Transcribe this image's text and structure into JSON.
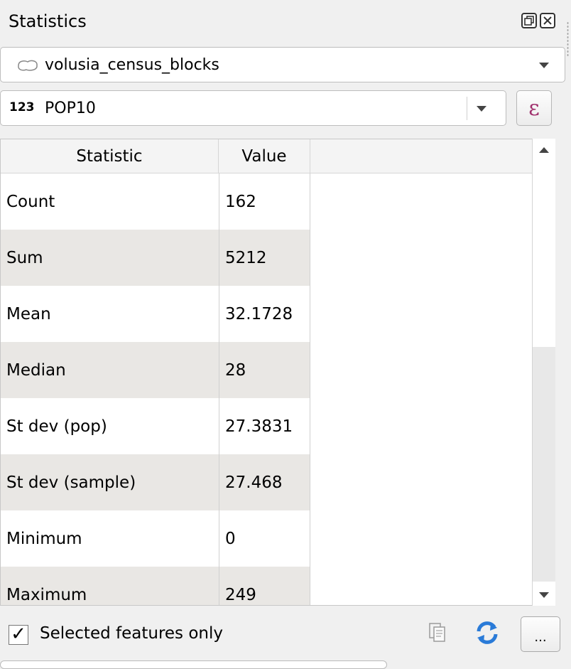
{
  "panel": {
    "title": "Statistics"
  },
  "layer_selector": {
    "value": "volusia_census_blocks",
    "icon": "polygon-layer-icon"
  },
  "field_selector": {
    "type_label": "123",
    "value": "POP10",
    "expression_label": "ε"
  },
  "table": {
    "headers": [
      "Statistic",
      "Value"
    ],
    "rows": [
      {
        "statistic": "Count",
        "value": "162"
      },
      {
        "statistic": "Sum",
        "value": "5212"
      },
      {
        "statistic": "Mean",
        "value": "32.1728"
      },
      {
        "statistic": "Median",
        "value": "28"
      },
      {
        "statistic": "St dev (pop)",
        "value": "27.3831"
      },
      {
        "statistic": "St dev (sample)",
        "value": "27.468"
      },
      {
        "statistic": "Minimum",
        "value": "0"
      },
      {
        "statistic": "Maximum",
        "value": "249"
      }
    ]
  },
  "bottom": {
    "checkbox_mark": "✓",
    "selected_only_label": "Selected features only",
    "more_label": "..."
  },
  "colors": {
    "alt_row": "#e9e7e4",
    "refresh_blue": "#2a7bd8",
    "expression_accent": "#a0306d"
  }
}
